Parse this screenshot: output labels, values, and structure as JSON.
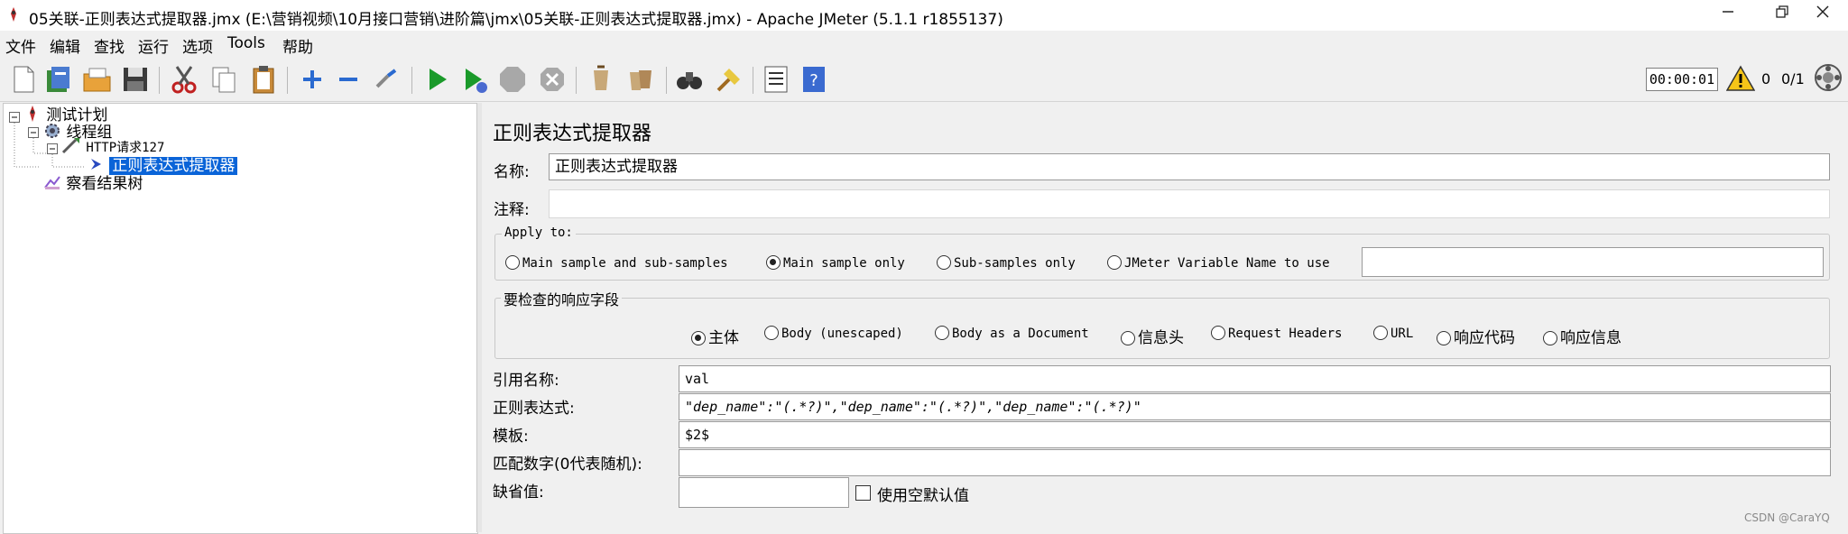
{
  "window": {
    "title": "05关联-正则表达式提取器.jmx (E:\\营销视频\\10月接口营销\\进阶篇\\jmx\\05关联-正则表达式提取器.jmx) - Apache JMeter (5.1.1 r1855137)"
  },
  "menu": [
    "文件",
    "编辑",
    "查找",
    "运行",
    "选项",
    "Tools",
    "帮助"
  ],
  "toolbar": {
    "icons": [
      "new-icon",
      "templates-icon",
      "open-icon",
      "save-icon",
      "cut-icon",
      "copy-icon",
      "paste-icon",
      "expand-icon",
      "collapse-icon",
      "toggle-icon",
      "start-icon",
      "start-no-pause-icon",
      "stop-icon",
      "shutdown-icon",
      "clear-icon",
      "clear-all-icon",
      "search-icon",
      "reset-search-icon",
      "function-helper-icon",
      "help-icon"
    ],
    "timer": "00:00:01",
    "warnings": "0",
    "threads": "0/1"
  },
  "tree": {
    "nodes": [
      {
        "label": "测试计划",
        "icon": "test-plan-icon"
      },
      {
        "label": "线程组",
        "icon": "thread-group-icon"
      },
      {
        "label": "HTTP请求127",
        "icon": "http-sampler-icon"
      },
      {
        "label": "正则表达式提取器",
        "icon": "extractor-icon",
        "selected": true
      },
      {
        "label": "察看结果树",
        "icon": "listener-icon"
      }
    ]
  },
  "panel": {
    "title": "正则表达式提取器",
    "name_label": "名称:",
    "name_value": "正则表达式提取器",
    "comment_label": "注释:",
    "apply_to": {
      "title": "Apply to:",
      "options": [
        "Main sample and sub-samples",
        "Main sample only",
        "Sub-samples only",
        "JMeter Variable Name to use"
      ],
      "selected": "Main sample only",
      "variable_value": ""
    },
    "field_to_check": {
      "title": "要检查的响应字段",
      "options": [
        "主体",
        "Body (unescaped)",
        "Body as a Document",
        "信息头",
        "Request Headers",
        "URL",
        "响应代码",
        "响应信息"
      ],
      "selected": "主体"
    },
    "ref_name_label": "引用名称:",
    "ref_name_value": "val",
    "regex_label": "正则表达式:",
    "regex_value": "\"dep_name\":\"(.*?)\",\"dep_name\":\"(.*?)\",\"dep_name\":\"(.*?)\"",
    "template_label": "模板:",
    "template_value": "$2$",
    "match_no_label": "匹配数字(0代表随机):",
    "match_no_value": "",
    "default_label": "缺省值:",
    "default_value": "",
    "use_empty_label": "使用空默认值",
    "use_empty_checked": false
  },
  "watermark": "CSDN @CaraYQ",
  "colors": {
    "selection": "#0a64d8",
    "play": "#1a9a2a"
  }
}
